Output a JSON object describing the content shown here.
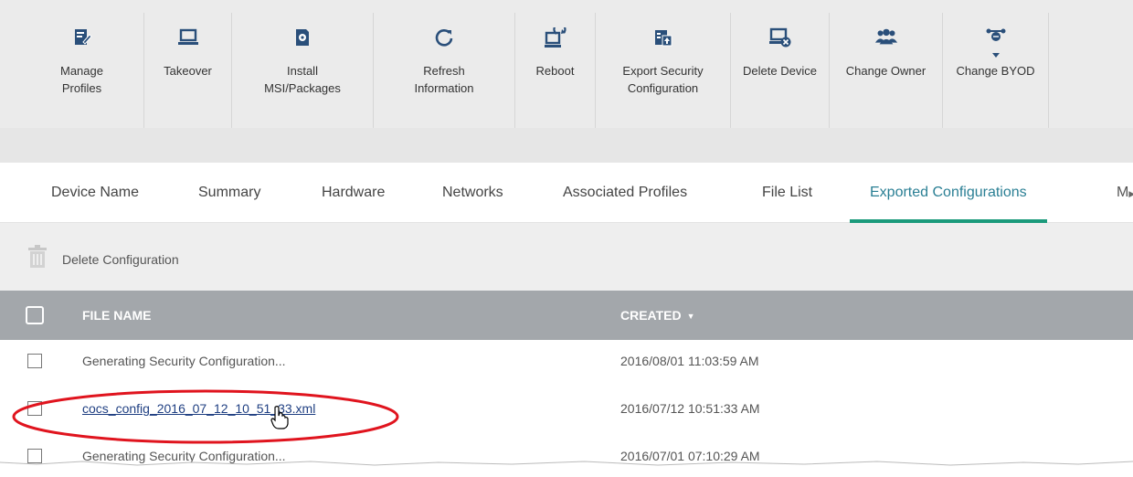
{
  "toolbar": {
    "items": [
      {
        "label": "Manage\nProfiles",
        "icon": "manage-profiles-icon",
        "width": 136
      },
      {
        "label": "Takeover",
        "icon": "laptop-icon",
        "width": 96
      },
      {
        "label": "Install\nMSI/Packages",
        "icon": "install-package-icon",
        "width": 155
      },
      {
        "label": "Refresh\nInformation",
        "icon": "refresh-icon",
        "width": 155
      },
      {
        "label": "Reboot",
        "icon": "reboot-icon",
        "width": 88
      },
      {
        "label": "Export Security\nConfiguration",
        "icon": "export-config-icon",
        "width": 148
      },
      {
        "label": "Delete Device",
        "icon": "delete-device-icon",
        "width": 108
      },
      {
        "label": "Change Owner",
        "icon": "change-owner-icon",
        "width": 124
      },
      {
        "label": "Change BYOD",
        "icon": "change-byod-icon",
        "width": 116
      }
    ]
  },
  "tabs": {
    "items": [
      "Device Name",
      "Summary",
      "Hardware",
      "Networks",
      "Associated Profiles",
      "File List",
      "Exported Configurations"
    ],
    "active": "Exported Configurations",
    "overflow": "M"
  },
  "actions": {
    "delete_label": "Delete Configuration"
  },
  "table": {
    "columns": [
      "FILE NAME",
      "CREATED"
    ],
    "rows": [
      {
        "name": "Generating Security Configuration...",
        "created": "2016/08/01 11:03:59 AM",
        "link": false
      },
      {
        "name": "cocs_config_2016_07_12_10_51_33.xml",
        "created": "2016/07/12 10:51:33 AM",
        "link": true
      },
      {
        "name": "Generating Security Configuration...",
        "created": "2016/07/01 07:10:29 AM",
        "link": false
      }
    ]
  },
  "colors": {
    "icon_blue": "#2a4f7a",
    "active_tab": "#2a7f94",
    "active_underline": "#1b9a7b",
    "header_bg": "#a3a7ab",
    "highlight_ellipse": "#e0141e",
    "link": "#1f3f82"
  }
}
